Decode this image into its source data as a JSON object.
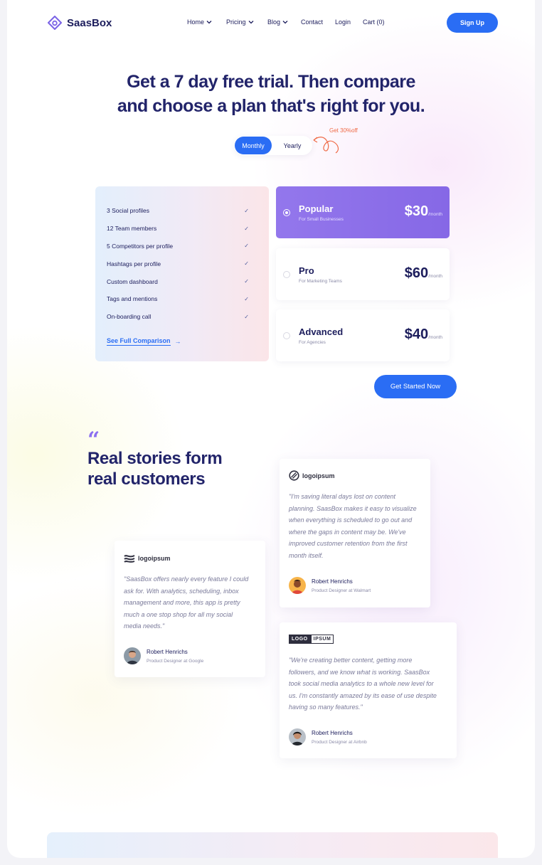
{
  "nav": {
    "brand": "SaasBox",
    "items": [
      {
        "label": "Home",
        "dropdown": true
      },
      {
        "label": "Pricing",
        "dropdown": true
      },
      {
        "label": "Blog",
        "dropdown": true
      },
      {
        "label": "Contact",
        "dropdown": false
      },
      {
        "label": "Login",
        "dropdown": false
      },
      {
        "label": "Cart (0)",
        "dropdown": false
      }
    ],
    "signup_label": "Sign Up"
  },
  "hero": {
    "title_line1": "Get a 7 day free trial. Then compare",
    "title_line2": "and choose a plan that's right for you.",
    "toggle_monthly": "Monthly",
    "toggle_yearly": "Yearly",
    "selected_period": "Monthly",
    "discount_note": "Get 30%off"
  },
  "features": {
    "items": [
      "3 Social profiles",
      "12 Team members",
      "5 Competitors per profile",
      "Hashtags per profile",
      "Custom dashboard",
      "Tags and mentions",
      "On-boarding call"
    ],
    "compare_link": "See Full Comparison"
  },
  "plans": [
    {
      "name": "Popular",
      "subtitle": "For Small Businesses",
      "price": "$30",
      "period": "/month",
      "selected": true
    },
    {
      "name": "Pro",
      "subtitle": "For Marketing Teams",
      "price": "$60",
      "period": "/month",
      "selected": false
    },
    {
      "name": "Advanced",
      "subtitle": "For Agencies",
      "price": "$40",
      "period": "/month",
      "selected": false
    }
  ],
  "cta_label": "Get Started Now",
  "testimonials": {
    "title_line1": "Real stories form",
    "title_line2": "real customers",
    "cards": [
      {
        "logo": "logoipsum",
        "quote_lines": [
          "\"I'm saving literal days lost on content",
          "planning. SaasBox makes it easy to visualize",
          "when everything is scheduled to go out and",
          "where the gaps in content may be. We've",
          "improved customer retention from the first",
          "month itself."
        ],
        "author": "Robert Henrichs",
        "role": "Product Designer at Walmart"
      },
      {
        "logo": "logoipsum",
        "quote_lines": [
          "\"SaasBox offers nearly every feature I could",
          "ask for. With analytics, scheduling, inbox",
          "management and more, this app is pretty",
          "much a one stop shop for all my social",
          "media needs.\""
        ],
        "author": "Robert Henrichs",
        "role": "Product Designer at Google"
      },
      {
        "logo_part1": "LOGO",
        "logo_part2": "IPSUM",
        "quote_lines": [
          "\"We're creating better content, getting more",
          "followers, and we know what is working. SaasBox",
          "took social media analytics to a whole new level for",
          "us. I'm constantly amazed by its ease of use despite",
          "having so many features.\""
        ],
        "author": "Robert Henrichs",
        "role": "Product Designer at Airbnb"
      }
    ]
  },
  "colors": {
    "primary": "#2a6df4",
    "accent_purple": "#8b6ff0",
    "heading": "#22246a",
    "discount": "#ef6a46"
  }
}
